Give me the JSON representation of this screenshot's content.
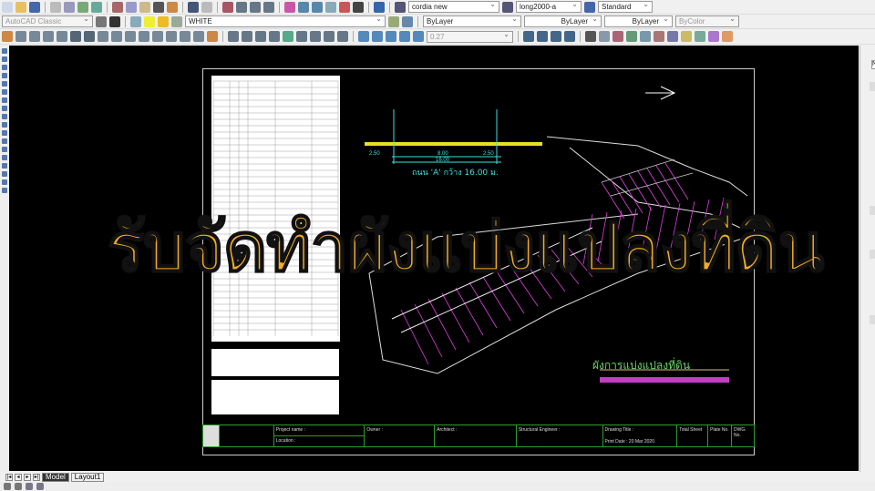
{
  "toolbar": {
    "text_style": "cordia new",
    "dim_style": "long2000-a",
    "table_style": "Standard",
    "workspace": "AutoCAD Classic",
    "layer": "WHITE",
    "color": "ByLayer",
    "linetype": "ByLayer",
    "lineweight": "ByLayer",
    "plotstyle": "ByColor",
    "scale_value": "0.27"
  },
  "overlay_title": "รับจัดทำผังแบ่งแปลงที่ดิน",
  "drawing": {
    "plan_title": "ผังการแบ่งแปลงที่ดิน",
    "road_label": "ถนน 'A' กว้าง 16.00 ม.",
    "road_dims": [
      "2.50",
      "8.00",
      "2.50",
      "16.00"
    ],
    "title_block": {
      "project": "Project name :",
      "location": "Location :",
      "owner": "Owner :",
      "architect": "Architect :",
      "engineer": "Structural Engineer :",
      "drawing_title": "Drawing Title :",
      "print_date": "Print Date : 20 Mar 2020",
      "total_sheet": "Total Sheet",
      "plate_no": "Plate No.",
      "dwg_no": "DWG. No."
    }
  },
  "layout_tabs": [
    "Model",
    "Layout1"
  ],
  "right_panel": {
    "field": "N"
  },
  "colors": {
    "accent": "#f3ad25",
    "canvas": "#000000",
    "magenta": "#e040e0",
    "green": "#2e9c2e"
  }
}
